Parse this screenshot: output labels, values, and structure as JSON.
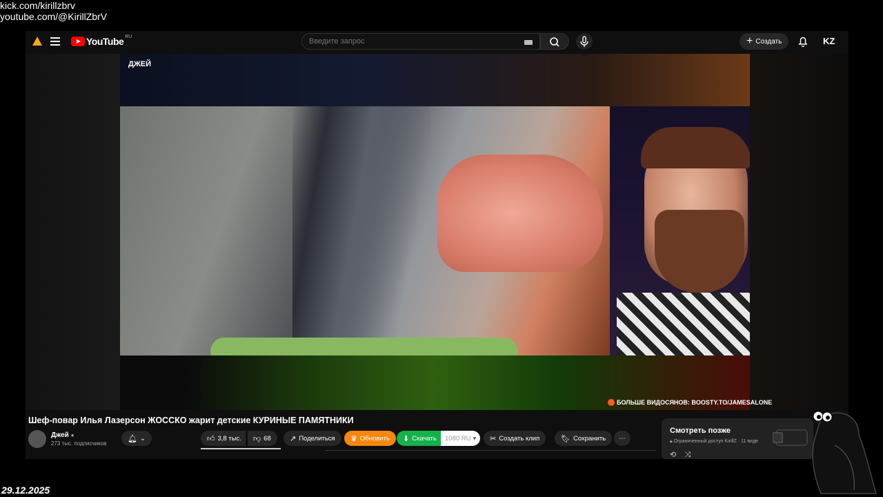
{
  "overlay": {
    "link1": "kick.com/kirillzbrv",
    "link2": "youtube.com/@KirillZbrV",
    "date": "29.12.2025"
  },
  "header": {
    "logo": "YouTube",
    "logo_region": "RU",
    "search_placeholder": "Введите запрос",
    "create_label": "Создать",
    "account_initials": "KZ"
  },
  "player": {
    "source_channel": "ДЖЕЙ",
    "boosty_text": "БОЛЬШЕ ВИДОСЯНОВ: BOOSTY.TO/JAMESALONE"
  },
  "video": {
    "title": "Шеф-повар Илья Лазерсон ЖОССКО жарит детские КУРИНЫЕ ПАМЯТНИКИ",
    "channel_name": "Джей",
    "subscribers": "273 тыс. подписчиков",
    "likes": "3,8 тыс.",
    "dislikes": "68",
    "share_label": "Поделиться",
    "upgrade_label": "Обновить",
    "download_label": "Скачать",
    "quality_label": "1080 RU",
    "clip_label": "Создать клип",
    "save_label": "Сохранить",
    "more_label": "⋯"
  },
  "watch_later": {
    "title": "Смотреть позже",
    "subtitle": "Ограниченный доступ KirillZ · 11 виде"
  },
  "colors": {
    "accent_red": "#ff0000",
    "upgrade_orange": "#f4870e",
    "download_green": "#14b24a"
  }
}
